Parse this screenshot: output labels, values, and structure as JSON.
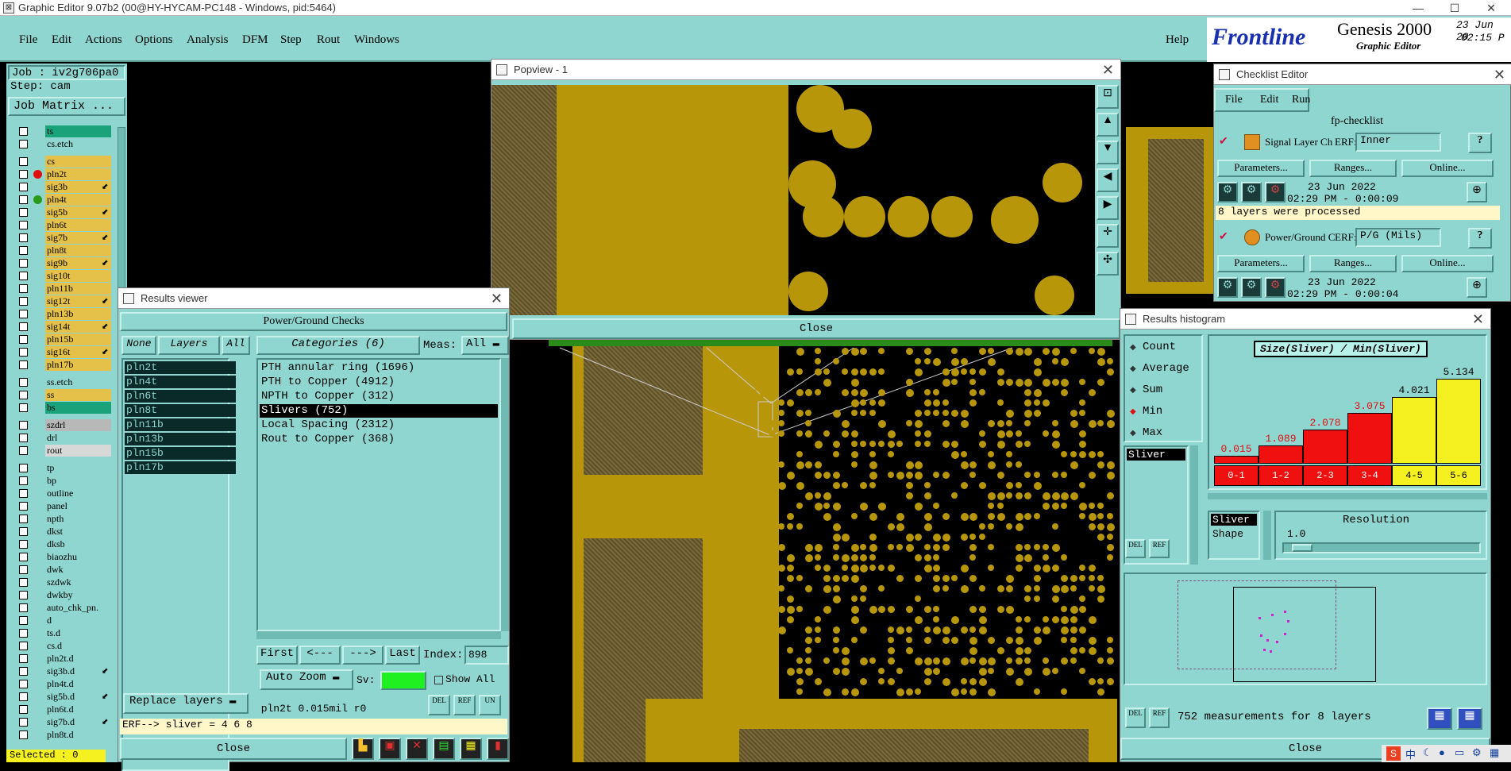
{
  "window": {
    "title": "Graphic Editor 9.07b2 (00@HY-HYCAM-PC148 - Windows, pid:5464)",
    "min": "—",
    "max": "☐",
    "close": "✕"
  },
  "menu": {
    "items": [
      "File",
      "Edit",
      "Actions",
      "Options",
      "Analysis",
      "DFM",
      "Step",
      "Rout",
      "Windows"
    ],
    "help": "Help"
  },
  "brand": {
    "logo": "Frontline",
    "product": "Genesis 2000",
    "subtitle": "Graphic Editor",
    "date": "23 Jun 20",
    "time": "02:15 P"
  },
  "job": {
    "job": "Job : iv2g706pa0",
    "step": "Step: cam",
    "matrix_button": "Job Matrix ..."
  },
  "layers": [
    {
      "name": "ts",
      "color": "#1aa37a"
    },
    {
      "name": "cs.etch",
      "color": "#8ed6cf"
    },
    {
      "name": "cs",
      "color": "#e6c14a"
    },
    {
      "name": "pln2t",
      "color": "#e6c14a",
      "mark": "red"
    },
    {
      "name": "sig3b",
      "color": "#e6c14a",
      "flag": "⬋"
    },
    {
      "name": "pln4t",
      "color": "#e6c14a",
      "mark": "green"
    },
    {
      "name": "sig5b",
      "color": "#e6c14a",
      "flag": "⬋"
    },
    {
      "name": "pln6t",
      "color": "#e6c14a"
    },
    {
      "name": "sig7b",
      "color": "#e6c14a",
      "flag": "⬋"
    },
    {
      "name": "pln8t",
      "color": "#e6c14a"
    },
    {
      "name": "sig9b",
      "color": "#e6c14a",
      "flag": "⬋"
    },
    {
      "name": "sig10t",
      "color": "#e6c14a"
    },
    {
      "name": "pln11b",
      "color": "#e6c14a"
    },
    {
      "name": "sig12t",
      "color": "#e6c14a",
      "flag": "⬋"
    },
    {
      "name": "pln13b",
      "color": "#e6c14a"
    },
    {
      "name": "sig14t",
      "color": "#e6c14a",
      "flag": "⬋"
    },
    {
      "name": "pln15b",
      "color": "#e6c14a"
    },
    {
      "name": "sig16t",
      "color": "#e6c14a",
      "flag": "⬋"
    },
    {
      "name": "pln17b",
      "color": "#e6c14a"
    },
    {
      "name": "ss.etch",
      "color": "#8ed6cf"
    },
    {
      "name": "ss",
      "color": "#e6c14a"
    },
    {
      "name": "bs",
      "color": "#1aa37a"
    },
    {
      "name": "szdrl",
      "color": "#b8b8b8"
    },
    {
      "name": "drl",
      "color": "#8ed6cf"
    },
    {
      "name": "rout",
      "color": "#d8d8d8"
    },
    {
      "name": "tp",
      "color": "#8ed6cf"
    },
    {
      "name": "bp",
      "color": "#8ed6cf"
    },
    {
      "name": "outline",
      "color": "#8ed6cf"
    },
    {
      "name": "panel",
      "color": "#8ed6cf"
    },
    {
      "name": "npth",
      "color": "#8ed6cf"
    },
    {
      "name": "dkst",
      "color": "#8ed6cf"
    },
    {
      "name": "dksb",
      "color": "#8ed6cf"
    },
    {
      "name": "biaozhu",
      "color": "#8ed6cf"
    },
    {
      "name": "dwk",
      "color": "#8ed6cf"
    },
    {
      "name": "szdwk",
      "color": "#8ed6cf"
    },
    {
      "name": "dwkby",
      "color": "#8ed6cf"
    },
    {
      "name": "auto_chk_pn.",
      "color": "#8ed6cf"
    },
    {
      "name": "d",
      "color": "#8ed6cf"
    },
    {
      "name": "ts.d",
      "color": "#8ed6cf"
    },
    {
      "name": "cs.d",
      "color": "#8ed6cf"
    },
    {
      "name": "pln2t.d",
      "color": "#8ed6cf"
    },
    {
      "name": "sig3b.d",
      "color": "#8ed6cf",
      "flag": "⬋"
    },
    {
      "name": "pln4t.d",
      "color": "#8ed6cf"
    },
    {
      "name": "sig5b.d",
      "color": "#8ed6cf",
      "flag": "⬋"
    },
    {
      "name": "pln6t.d",
      "color": "#8ed6cf"
    },
    {
      "name": "sig7b.d",
      "color": "#8ed6cf",
      "flag": "⬋"
    },
    {
      "name": "pln8t.d",
      "color": "#8ed6cf"
    }
  ],
  "selected": "Selected : 0",
  "popview": {
    "title": "Popview - 1",
    "close": "Close"
  },
  "results_viewer": {
    "title": "Results viewer",
    "header": "Power/Ground Checks",
    "tabs": {
      "none": "None",
      "layers": "Layers",
      "all": "All"
    },
    "categories_label": "Categories (6)",
    "meas_label": "Meas:",
    "meas_value": "All",
    "layer_list": [
      "pln2t",
      "pln4t",
      "pln6t",
      "pln8t",
      "pln11b",
      "pln13b",
      "pln15b",
      "pln17b"
    ],
    "categories": [
      "PTH annular ring (1696)",
      "PTH to Copper (4912)",
      "NPTH to Copper (312)",
      "Slivers (752)",
      "Local Spacing (2312)",
      "Rout to Copper (368)"
    ],
    "nav": {
      "first": "First",
      "prev": "<---",
      "next": "--->",
      "last": "Last",
      "index_label": "Index:",
      "index_value": "898"
    },
    "auto_zoom": "Auto Zoom",
    "sv_label": "Sv:",
    "show_all": "Show All",
    "replace_layers": "Replace layers",
    "info_line": "pln2t 0.015mil  r0",
    "erf_line": "ERF--> sliver = 4 6 8",
    "close": "Close"
  },
  "checklist": {
    "title": "Checklist Editor",
    "menu": [
      "File",
      "Edit",
      "Run"
    ],
    "name": "fp-checklist",
    "actions": [
      {
        "name": "Signal Layer Ch",
        "erf_label": "ERF:",
        "erf_value": "Inner",
        "params": "Parameters...",
        "ranges": "Ranges...",
        "online": "Online...",
        "date": "23 Jun 2022",
        "time": "02:29 PM - 0:00:09",
        "status": "8 layers were processed"
      },
      {
        "name": "Power/Ground C",
        "erf_label": "ERF:",
        "erf_value": "P/G (Mils)",
        "params": "Parameters...",
        "ranges": "Ranges...",
        "online": "Online...",
        "date": "23 Jun 2022",
        "time": "02:29 PM - 0:00:04"
      }
    ]
  },
  "histogram": {
    "title": "Results histogram",
    "options": [
      "Count",
      "Average",
      "Sum",
      "Min",
      "Max"
    ],
    "selected_option": "Min",
    "list_item": "Sliver",
    "chart_title": "Size(Sliver) / Min(Sliver)",
    "resolution_label": "Resolution",
    "resolution_value": "1.0",
    "shape_list": [
      "Sliver",
      "Shape"
    ],
    "status": "752 measurements for 8 layers",
    "close": "Close"
  },
  "chart_data": {
    "type": "bar",
    "title": "Size(Sliver) / Min(Sliver)",
    "categories": [
      "0-1",
      "1-2",
      "2-3",
      "3-4",
      "4-5",
      "5-6"
    ],
    "values": [
      0.015,
      1.089,
      2.078,
      3.075,
      4.021,
      5.134
    ],
    "colors": [
      "#f01010",
      "#f01010",
      "#f01010",
      "#f01010",
      "#f5f020",
      "#f5f020"
    ],
    "ylim": [
      0,
      5.5
    ]
  },
  "taskbar": {
    "ime": "中"
  }
}
